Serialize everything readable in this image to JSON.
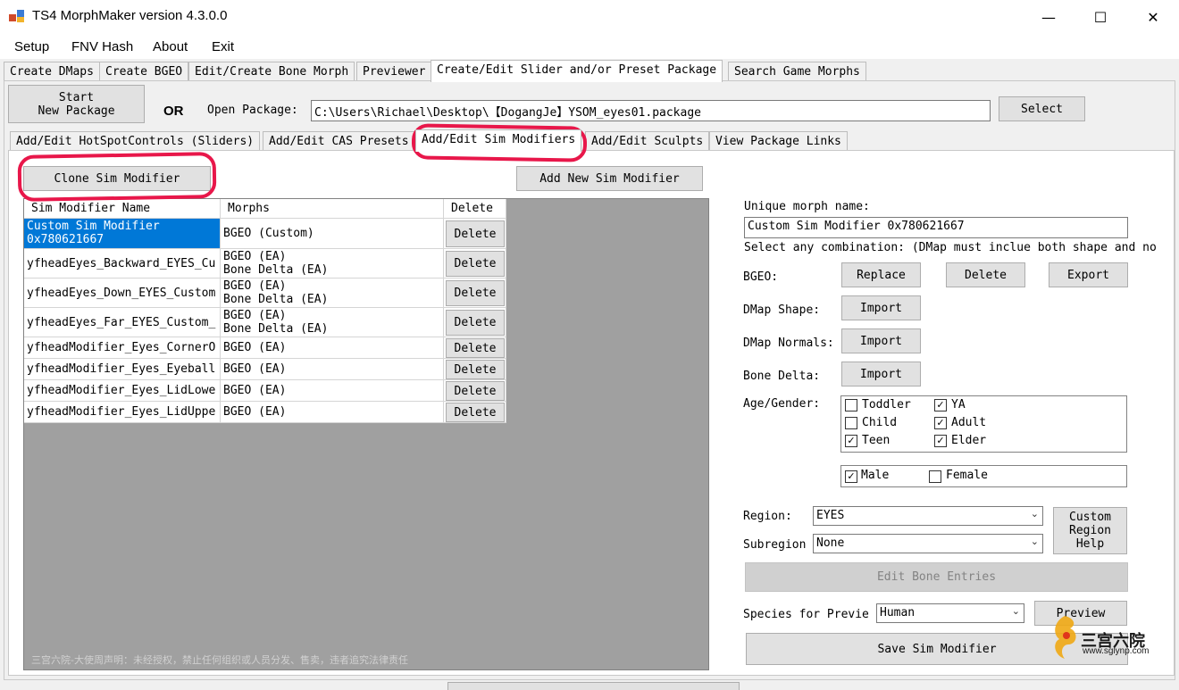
{
  "window": {
    "title": "TS4 MorphMaker version 4.3.0.0",
    "minimize_glyph": "—",
    "maximize_glyph": "☐",
    "close_glyph": "✕"
  },
  "menu": [
    "Setup",
    "FNV Hash",
    "About",
    "Exit"
  ],
  "main_tabs": [
    "Create DMaps",
    "Create BGEO",
    "Edit/Create Bone Morph",
    "Previewer",
    "Create/Edit Slider and/or Preset Package",
    "Search Game Morphs"
  ],
  "main_tab_selected": "Create/Edit Slider and/or Preset Package",
  "package": {
    "start_button": "Start\nNew Package",
    "or_label": "OR",
    "open_label": "Open Package:",
    "path": "C:\\Users\\Richael\\Desktop\\【DogangJe】YSOM_eyes01.package",
    "select_button": "Select"
  },
  "sub_tabs": [
    "Add/Edit HotSpotControls (Sliders)",
    "Add/Edit CAS Presets",
    "Add/Edit Sim Modifiers",
    "Add/Edit Sculpts",
    "View Package Links"
  ],
  "sub_tab_selected": "Add/Edit Sim Modifiers",
  "buttons": {
    "clone": "Clone Sim Modifier",
    "add_new": "Add New Sim Modifier"
  },
  "grid": {
    "headers": [
      "Sim Modifier Name",
      "Morphs",
      "Delete"
    ],
    "rows": [
      {
        "name": "Custom Sim Modifier\n0x780621667",
        "morphs": "BGEO (Custom)",
        "delete": "Delete",
        "selected": true
      },
      {
        "name": "yfheadEyes_Backward_EYES_Cu",
        "morphs": "BGEO (EA)\nBone Delta (EA)",
        "delete": "Delete"
      },
      {
        "name": "yfheadEyes_Down_EYES_Custom",
        "morphs": "BGEO (EA)\nBone Delta (EA)",
        "delete": "Delete"
      },
      {
        "name": "yfheadEyes_Far_EYES_Custom_",
        "morphs": "BGEO (EA)\nBone Delta (EA)",
        "delete": "Delete"
      },
      {
        "name": "yfheadModifier_Eyes_CornerO",
        "morphs": "BGEO (EA)",
        "delete": "Delete"
      },
      {
        "name": "yfheadModifier_Eyes_Eyeball",
        "morphs": "BGEO (EA)",
        "delete": "Delete"
      },
      {
        "name": "yfheadModifier_Eyes_LidLowe",
        "morphs": "BGEO (EA)",
        "delete": "Delete"
      },
      {
        "name": "yfheadModifier_Eyes_LidUppe",
        "morphs": "BGEO (EA)",
        "delete": "Delete"
      }
    ]
  },
  "details": {
    "unique_label": "Unique morph name:",
    "unique_value": "Custom Sim Modifier 0x780621667",
    "combo_hint": "Select any combination: (DMap must inclue both shape and no",
    "bgeo_label": "BGEO:",
    "bgeo_replace": "Replace",
    "bgeo_delete": "Delete",
    "bgeo_export": "Export",
    "dmap_shape_label": "DMap Shape:",
    "dmap_normals_label": "DMap Normals:",
    "bone_delta_label": "Bone Delta:",
    "import": "Import",
    "age_gender_label": "Age/Gender:",
    "ages": [
      {
        "label": "Toddler",
        "checked": false
      },
      {
        "label": "YA",
        "checked": true
      },
      {
        "label": "Child",
        "checked": false
      },
      {
        "label": "Adult",
        "checked": true
      },
      {
        "label": "Teen",
        "checked": true
      },
      {
        "label": "Elder",
        "checked": true
      }
    ],
    "genders": [
      {
        "label": "Male",
        "checked": true
      },
      {
        "label": "Female",
        "checked": false
      }
    ],
    "region_label": "Region:",
    "region_value": "EYES",
    "subregion_label": "Subregion",
    "subregion_value": "None",
    "custom_region_help": "Custom\nRegion\nHelp",
    "edit_bone_entries": "Edit Bone Entries",
    "species_label": "Species for Previe",
    "species_value": "Human",
    "preview_button": "Preview",
    "save_button": "Save Sim Modifier"
  },
  "watermark": {
    "notice": "三宫六院-大使周声明：未经授权，禁止任何组织或人员分发、售卖，违者追究法律责任",
    "logo_text": "三宫六院",
    "logo_url": "www.sglynp.com"
  },
  "colors": {
    "selection": "#0078d7",
    "red_circle": "#e8174a"
  }
}
